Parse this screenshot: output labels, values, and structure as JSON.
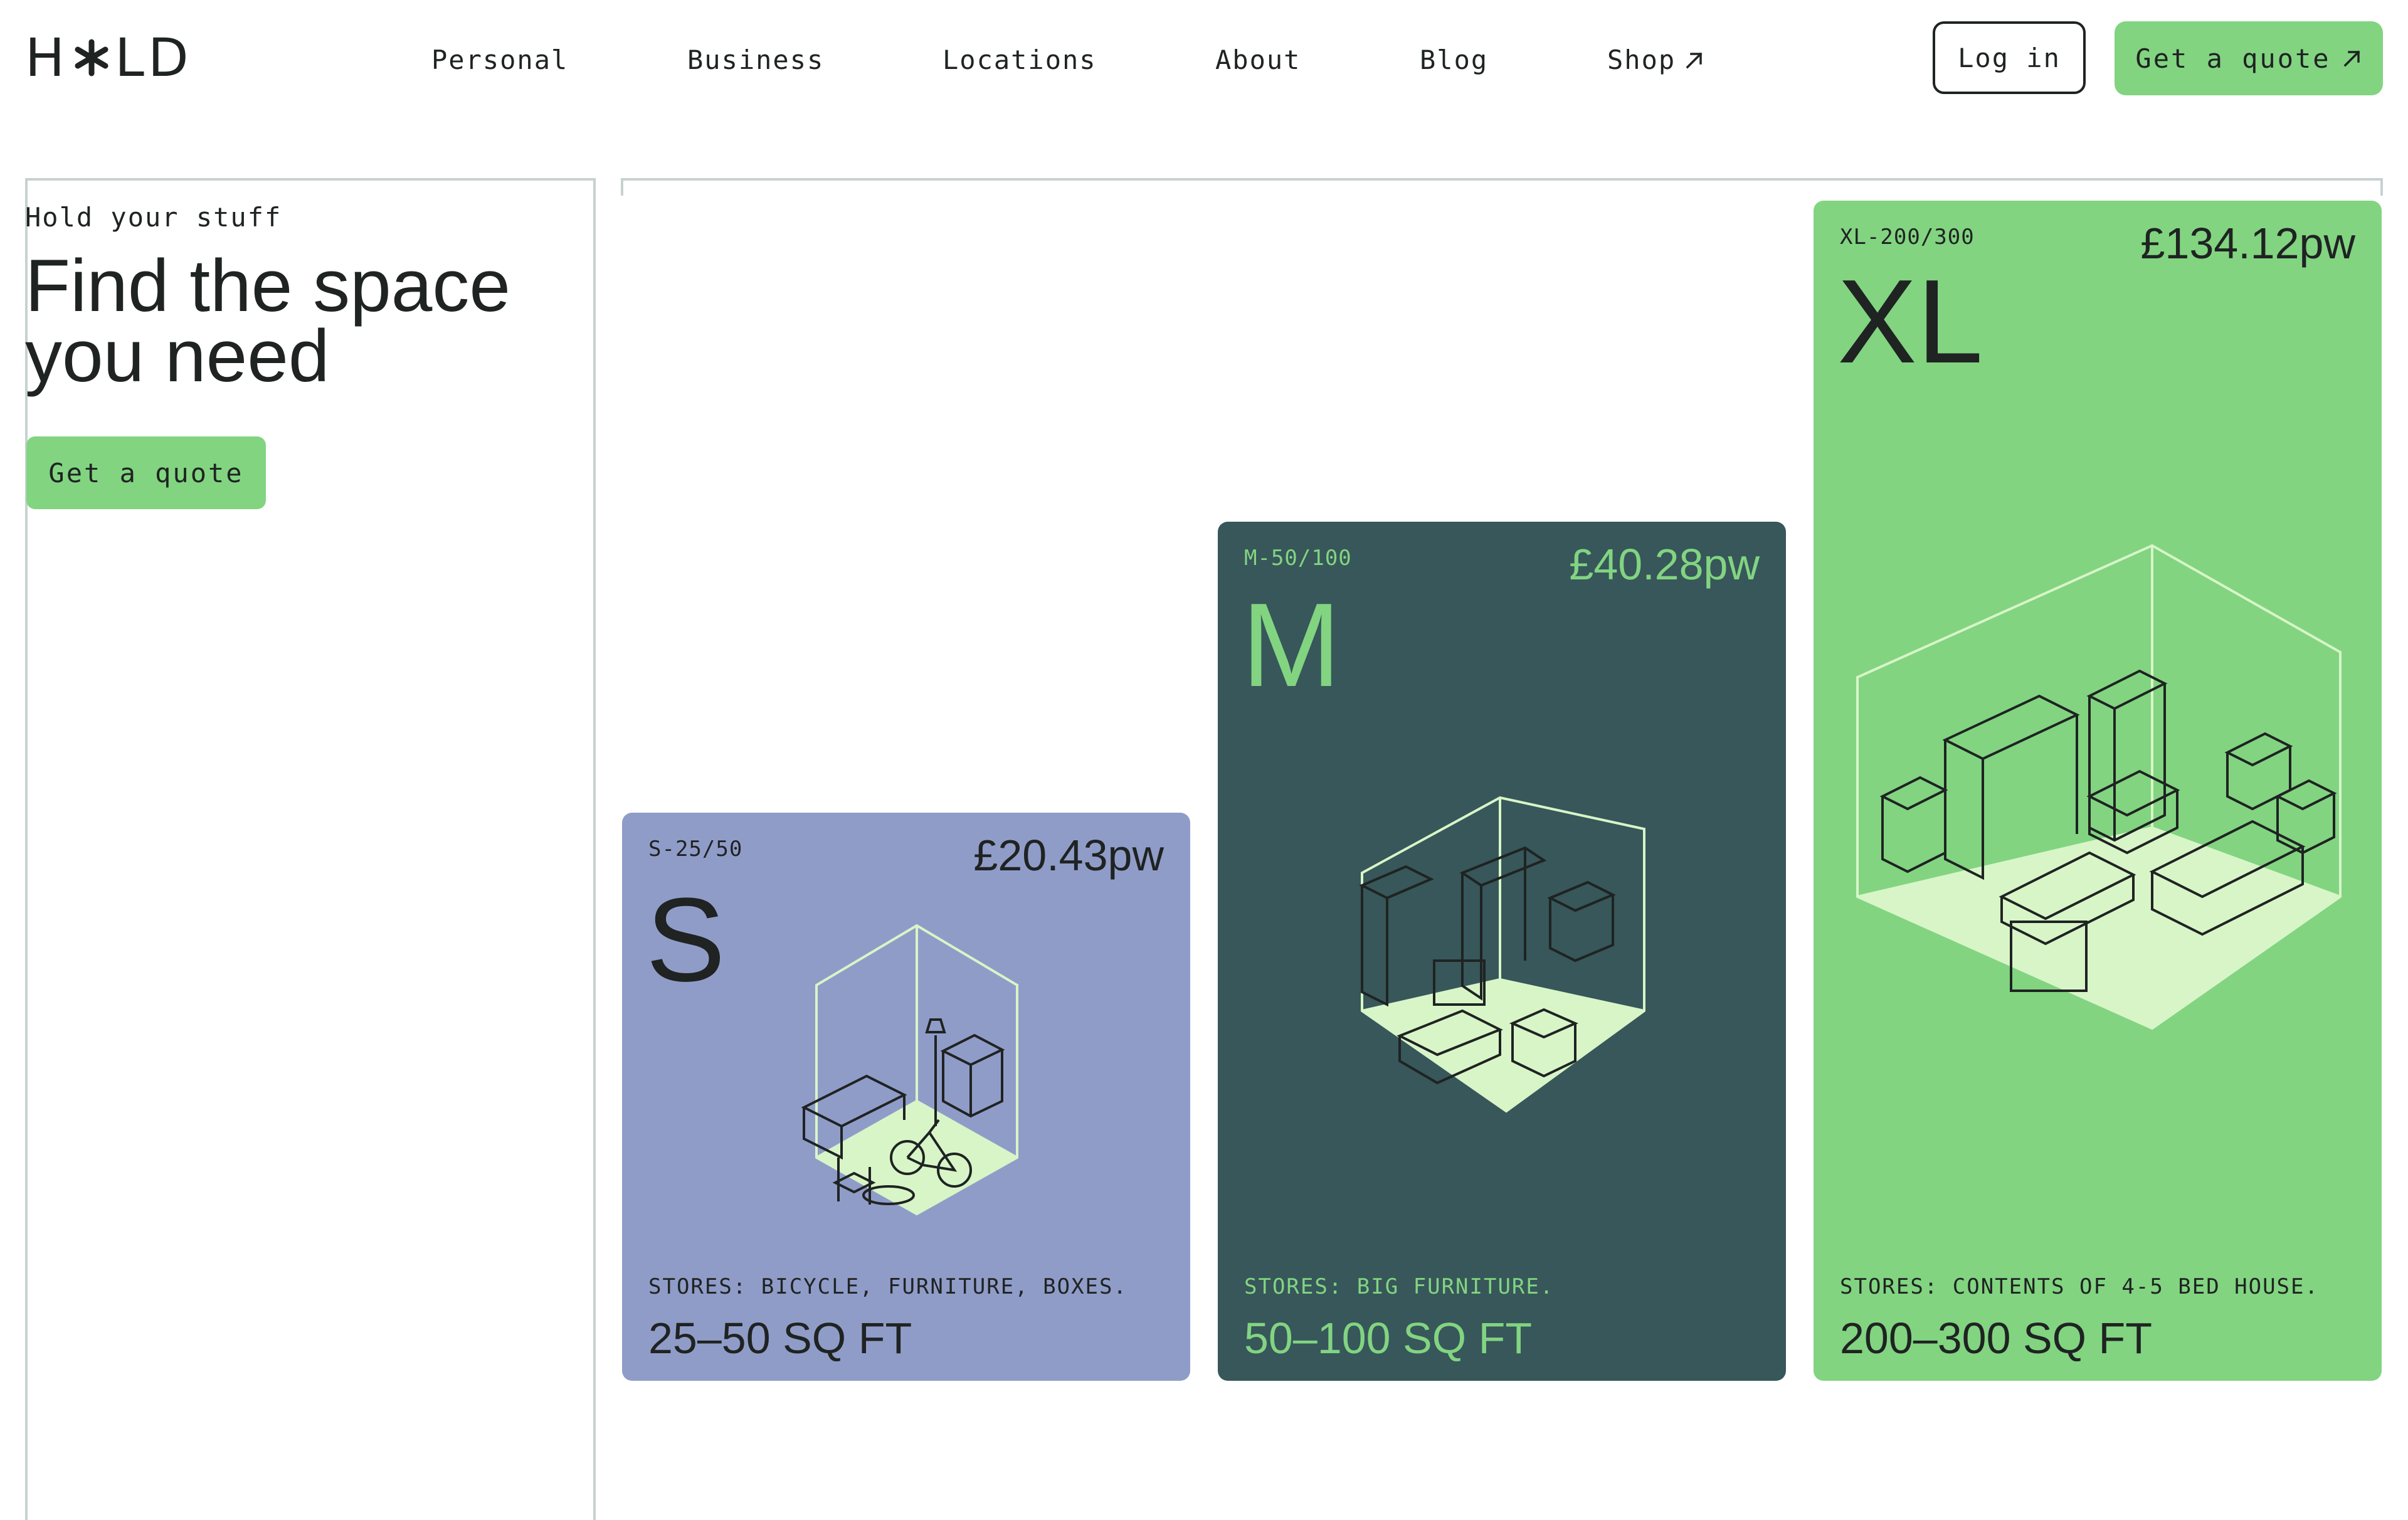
{
  "header": {
    "logo_text": "H*LD",
    "nav": [
      {
        "label": "Personal"
      },
      {
        "label": "Business"
      },
      {
        "label": "Locations"
      },
      {
        "label": "About"
      },
      {
        "label": "Blog"
      },
      {
        "label": "Shop",
        "icon": "external-arrow-icon"
      }
    ],
    "login_label": "Log in",
    "quote_label": "Get a quote",
    "quote_icon": "external-arrow-icon"
  },
  "hero": {
    "eyebrow": "Hold your stuff",
    "title_line1": "Find the space",
    "title_line2": "you need",
    "cta_label": "Get a quote"
  },
  "cards": {
    "s": {
      "code": "S-25/50",
      "price": "£20.43pw",
      "size": "S",
      "stores": "STORES: BICYCLE, FURNITURE, BOXES.",
      "sqft": "25–50 SQ FT",
      "bg": "#909cc8"
    },
    "m": {
      "code": "M-50/100",
      "price": "£40.28pw",
      "size": "M",
      "stores": "STORES: BIG FURNITURE.",
      "sqft": "50–100 SQ FT",
      "bg": "#37575a"
    },
    "xl": {
      "code": "XL-200/300",
      "price": "£134.12pw",
      "size": "XL",
      "stores": "STORES: CONTENTS OF 4-5 BED HOUSE.",
      "sqft": "200–300 SQ FT",
      "bg": "#82d481"
    }
  },
  "colors": {
    "accent": "#82d481",
    "floor": "#d8f5c8",
    "dark_teal": "#37575a",
    "lavender": "#909cc8"
  }
}
